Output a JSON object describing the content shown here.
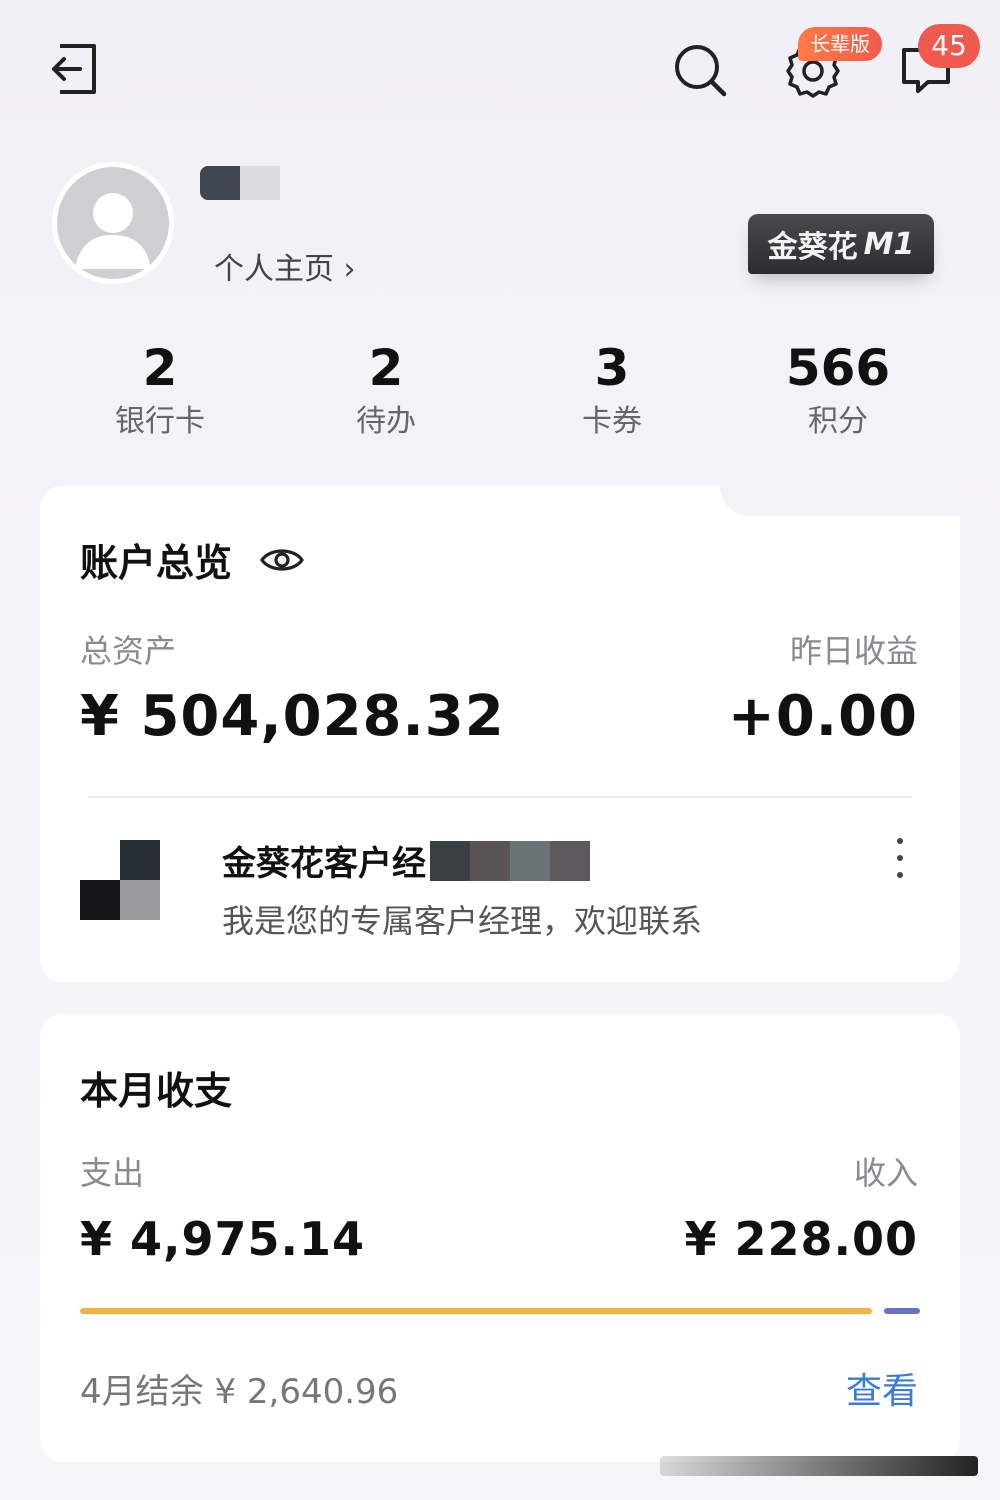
{
  "header": {
    "elder_mode_badge": "长辈版",
    "message_count": "45",
    "icons": [
      "exit-icon",
      "search-icon",
      "gear-icon",
      "message-icon"
    ]
  },
  "profile": {
    "homepage_link": "个人主页 ›",
    "member_badge_brand": "金葵花",
    "member_badge_tier": "M1"
  },
  "stats": [
    {
      "value": "2",
      "label": "银行卡"
    },
    {
      "value": "2",
      "label": "待办"
    },
    {
      "value": "3",
      "label": "卡券"
    },
    {
      "value": "566",
      "label": "积分"
    }
  ],
  "overview": {
    "title": "账户总览",
    "total_assets_label": "总资产",
    "total_assets_value": "¥ 504,028.32",
    "yesterday_income_label": "昨日收益",
    "yesterday_income_value": "+0.00",
    "manager_name": "金葵花客户经",
    "manager_desc": "我是您的专属客户经理，欢迎联系"
  },
  "budget": {
    "title": "本月收支",
    "expense_label": "支出",
    "expense_value": "¥ 4,975.14",
    "income_label": "收入",
    "income_value": "¥ 228.00",
    "balance_text": "4月结余 ¥ 2,640.96",
    "view_link": "查看",
    "expense_share": 0.956,
    "income_share": 0.044
  },
  "colors": {
    "expense_bar": "#f2b33f",
    "income_bar": "#6b72c9",
    "badge_red": "#f05a4e",
    "link_blue": "#3a7bd5"
  }
}
